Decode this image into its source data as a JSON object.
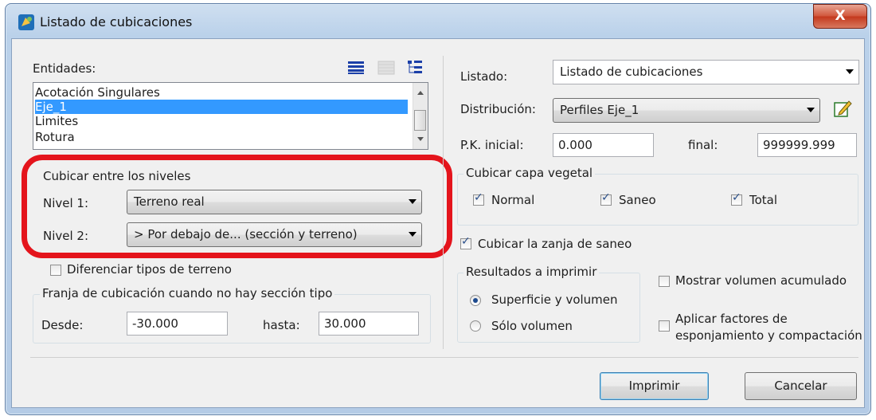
{
  "window": {
    "title": "Listado de cubicaciones",
    "close_label": "X"
  },
  "entities": {
    "label": "Entidades:",
    "items": [
      "Acotación Singulares",
      "Eje_1",
      "Limites",
      "Rotura"
    ],
    "selected_index": 1
  },
  "levels": {
    "group_title": "Cubicar entre los niveles",
    "nivel1_label": "Nivel 1:",
    "nivel1_value": "Terreno real",
    "nivel2_label": "Nivel 2:",
    "nivel2_value": "> Por debajo de... (sección y terreno)"
  },
  "diferenciar_label": "Diferenciar tipos de terreno",
  "franja": {
    "group_title": "Franja de cubicación cuando no hay sección tipo",
    "desde_label": "Desde:",
    "desde_value": "-30.000",
    "hasta_label": "hasta:",
    "hasta_value": "30.000"
  },
  "listado": {
    "label": "Listado:",
    "value": "Listado de cubicaciones"
  },
  "distribucion": {
    "label": "Distribución:",
    "value": "Perfiles Eje_1"
  },
  "pk": {
    "inicial_label": "P.K. inicial:",
    "inicial_value": "0.000",
    "final_label": "final:",
    "final_value": "999999.999"
  },
  "capa_vegetal": {
    "group_title": "Cubicar capa vegetal",
    "normal": "Normal",
    "saneo": "Saneo",
    "total": "Total"
  },
  "zanja_label": "Cubicar la zanja de saneo",
  "resultados": {
    "group_title": "Resultados a imprimir",
    "opt1": "Superficie y volumen",
    "opt2": "Sólo volumen"
  },
  "mostrar_label": "Mostrar volumen acumulado",
  "aplicar_label_1": "Aplicar factores de",
  "aplicar_label_2": "esponjamiento y compactación",
  "buttons": {
    "imprimir": "Imprimir",
    "cancelar": "Cancelar"
  },
  "colors": {
    "selection": "#3399ff",
    "highlight": "#e4141c",
    "title_gradient": "#bad1ea"
  }
}
